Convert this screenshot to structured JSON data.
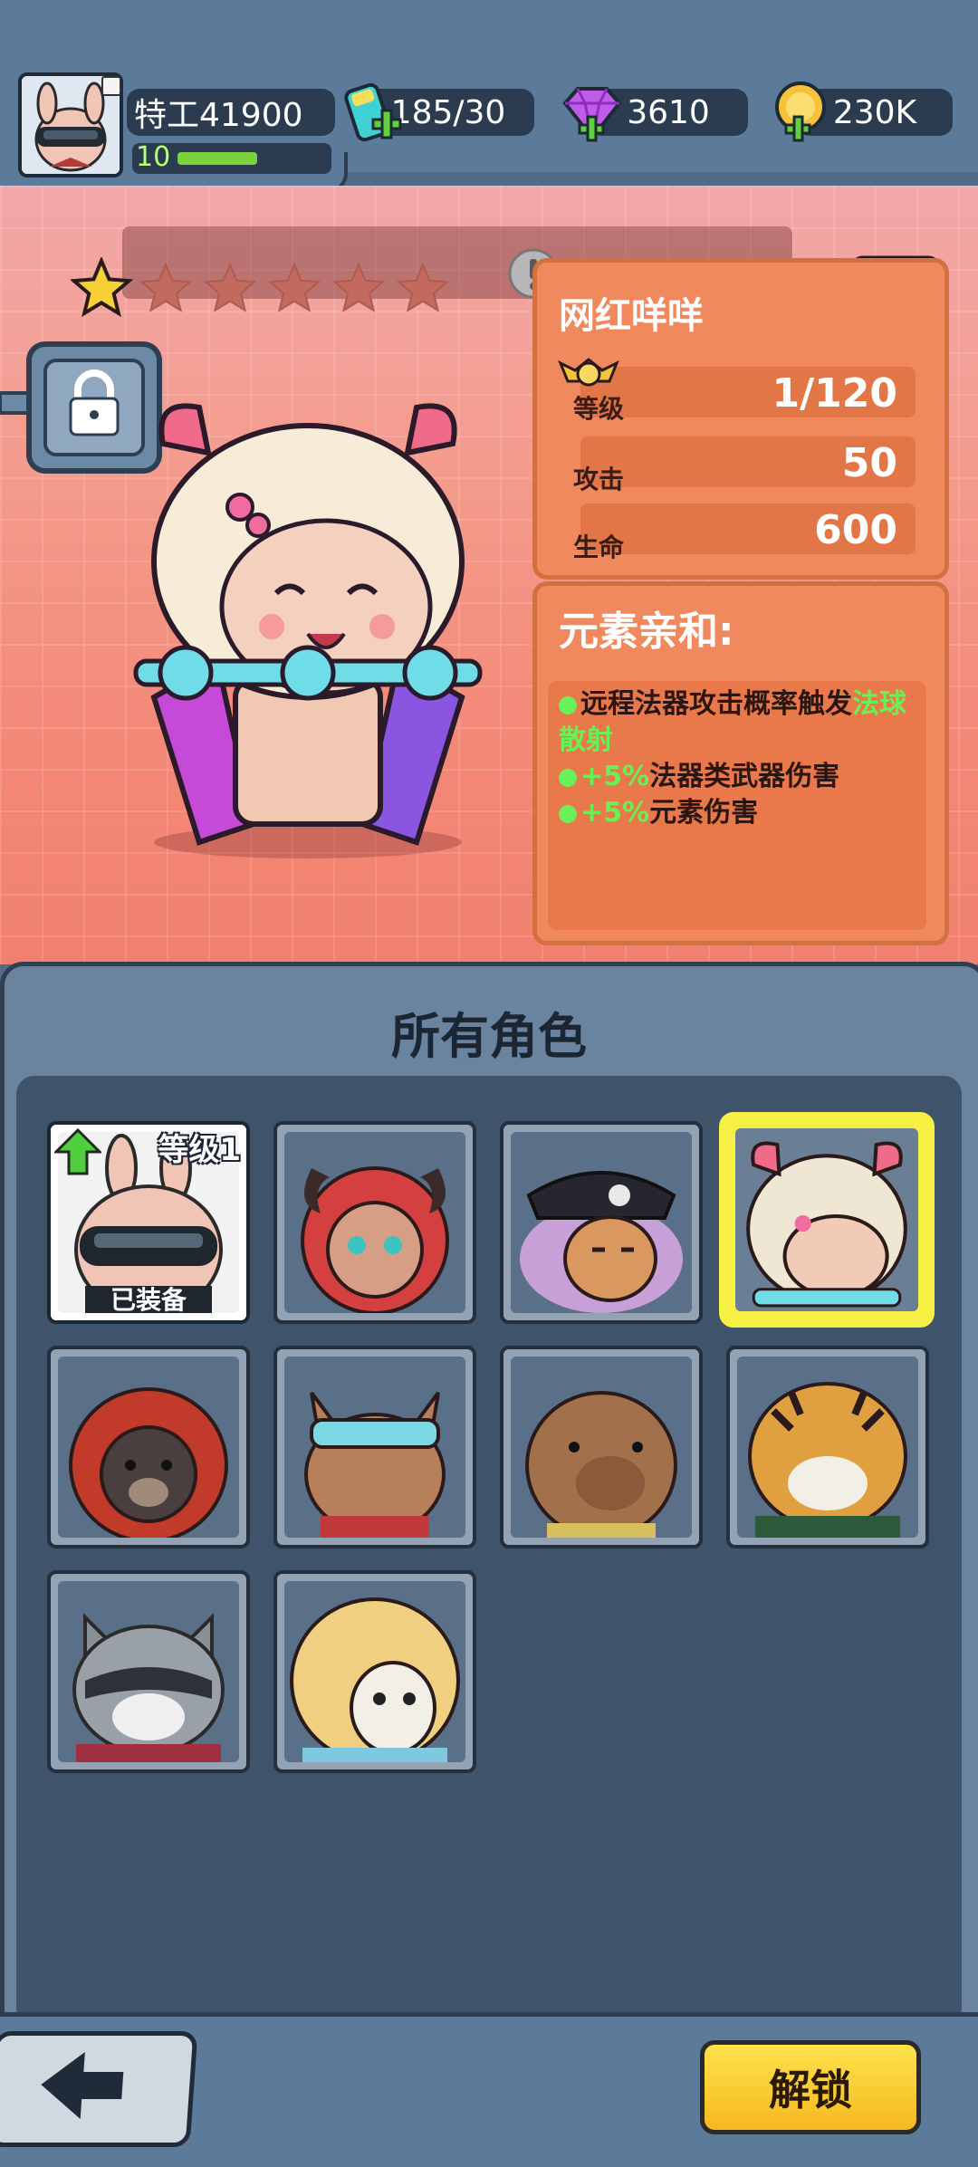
{
  "player": {
    "name": "特工41900",
    "level": "10",
    "xp_fraction": 0.55
  },
  "currencies": {
    "energy": "185/30",
    "gems": "3610",
    "coins": "230K"
  },
  "hero": {
    "name": "网红咩咩",
    "stars_filled": 1,
    "stars_total": 6,
    "level_value": "1/120",
    "level_label": "等级",
    "attack_label": "攻击",
    "attack_value": "50",
    "hp_label": "生命",
    "hp_value": "600"
  },
  "affinity": {
    "title": "元素亲和:",
    "line1_prefix": "远程法器攻击概率触发",
    "line1_highlight": "法球散射",
    "line2_highlight": "+5%",
    "line2_text": "法器类武器伤害",
    "line3_highlight": "+5%",
    "line3_text": "元素伤害"
  },
  "roster": {
    "title": "所有角色",
    "first_card_level": "等级1",
    "first_card_equipped": "已装备"
  },
  "buttons": {
    "unlock": "解锁"
  },
  "colors": {
    "accent_green": "#68f055",
    "selection_yellow": "#f5f043",
    "unlock_yellow": "#f5c628",
    "panel_orange": "#f08a5e"
  }
}
